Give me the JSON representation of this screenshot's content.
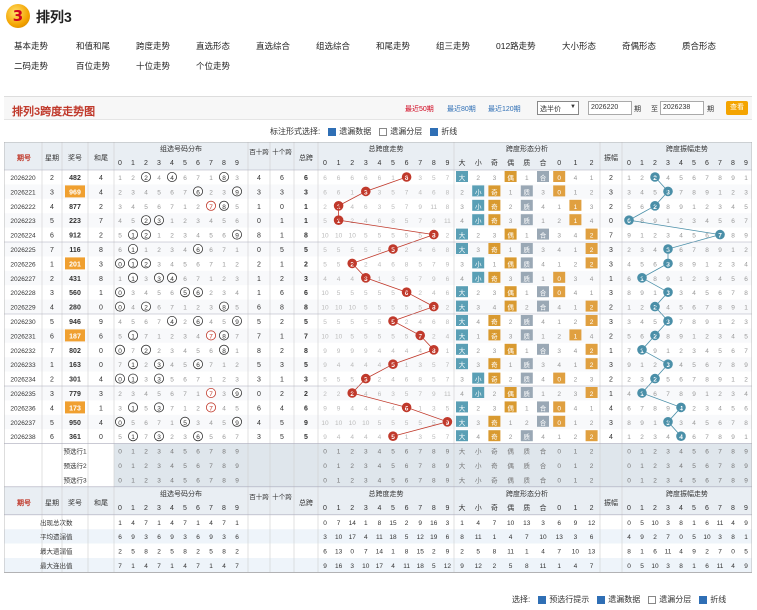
{
  "logo": {
    "badge": "3",
    "title": "排列3"
  },
  "nav": {
    "row1": [
      "基本走势",
      "和值和尾",
      "跨度走势",
      "直选形态",
      "直选综合",
      "组选综合",
      "和尾走势",
      "组三走势",
      "012路走势",
      "大小形态",
      "奇偶形态",
      "质合形态"
    ],
    "row2": [
      "二码走势",
      "百位走势",
      "十位走势",
      "个位走势"
    ]
  },
  "panel": {
    "title": "排列3跨度走势图",
    "recent50": "最近50期",
    "recent80": "最近80期",
    "recent120": "最近120期",
    "select_value": "选半价",
    "from_value": "2026220",
    "from_suffix": "期",
    "to_label": "至",
    "to_value": "2026238",
    "to_suffix": "期",
    "query": "查看"
  },
  "options": {
    "label": "标注形式选择:",
    "items": [
      {
        "label": "遗漏数据",
        "checked": true
      },
      {
        "label": "遗漏分层",
        "checked": false
      },
      {
        "label": "折线",
        "checked": true
      }
    ]
  },
  "table": {
    "h_period": "期号",
    "h_week": "星期",
    "h_prize": "奖号",
    "h_sumtail": "和尾",
    "h_combo": "组选号码分布",
    "h_bs": "百十跨",
    "h_tg": "十个跨",
    "h_total": "总跨",
    "h_totaltrend": "总跨度走势",
    "h_shape": "跨度形态分析",
    "h_swing": "振幅",
    "h_swingtrend": "跨度振幅走势",
    "shape_cols": [
      "大",
      "小",
      "奇",
      "偶",
      "质",
      "合",
      "0",
      "1",
      "2"
    ],
    "digits": [
      "0",
      "1",
      "2",
      "3",
      "4",
      "5",
      "6",
      "7",
      "8",
      "9"
    ],
    "rows": [
      {
        "p": "2026220",
        "w": "2",
        "n": "482",
        "t": "4",
        "bs": "4",
        "tg": "6",
        "sp": 6,
        "sw": "2"
      },
      {
        "p": "2026221",
        "w": "3",
        "n": "969",
        "t": "4",
        "bs": "3",
        "tg": "3",
        "sp": 3,
        "sw": "3"
      },
      {
        "p": "2026222",
        "w": "4",
        "n": "877",
        "t": "2",
        "bs": "1",
        "tg": "0",
        "sp": 1,
        "sw": "2"
      },
      {
        "p": "2026223",
        "w": "5",
        "n": "223",
        "t": "7",
        "bs": "0",
        "tg": "1",
        "sp": 1,
        "sw": "0"
      },
      {
        "p": "2026224",
        "w": "6",
        "n": "912",
        "t": "2",
        "bs": "8",
        "tg": "1",
        "sp": 8,
        "sw": "7"
      },
      {
        "p": "2026225",
        "w": "7",
        "n": "116",
        "t": "8",
        "bs": "0",
        "tg": "5",
        "sp": 5,
        "sw": "3"
      },
      {
        "p": "2026226",
        "w": "1",
        "n": "201",
        "t": "3",
        "bs": "2",
        "tg": "1",
        "sp": 2,
        "sw": "3"
      },
      {
        "p": "2026227",
        "w": "2",
        "n": "431",
        "t": "8",
        "bs": "1",
        "tg": "2",
        "sp": 3,
        "sw": "1"
      },
      {
        "p": "2026228",
        "w": "3",
        "n": "560",
        "t": "1",
        "bs": "1",
        "tg": "6",
        "sp": 6,
        "sw": "3"
      },
      {
        "p": "2026229",
        "w": "4",
        "n": "280",
        "t": "0",
        "bs": "6",
        "tg": "8",
        "sp": 8,
        "sw": "2"
      },
      {
        "p": "2026230",
        "w": "5",
        "n": "946",
        "t": "9",
        "bs": "5",
        "tg": "2",
        "sp": 5,
        "sw": "3"
      },
      {
        "p": "2026231",
        "w": "6",
        "n": "187",
        "t": "6",
        "bs": "7",
        "tg": "1",
        "sp": 7,
        "sw": "2"
      },
      {
        "p": "2026232",
        "w": "7",
        "n": "802",
        "t": "0",
        "bs": "8",
        "tg": "2",
        "sp": 8,
        "sw": "1"
      },
      {
        "p": "2026233",
        "w": "1",
        "n": "163",
        "t": "0",
        "bs": "5",
        "tg": "3",
        "sp": 5,
        "sw": "3"
      },
      {
        "p": "2026234",
        "w": "2",
        "n": "301",
        "t": "4",
        "bs": "3",
        "tg": "1",
        "sp": 3,
        "sw": "2"
      },
      {
        "p": "2026235",
        "w": "3",
        "n": "779",
        "t": "3",
        "bs": "0",
        "tg": "2",
        "sp": 2,
        "sw": "1"
      },
      {
        "p": "2026236",
        "w": "4",
        "n": "173",
        "t": "1",
        "bs": "6",
        "tg": "4",
        "sp": 6,
        "sw": "4"
      },
      {
        "p": "2026237",
        "w": "5",
        "n": "950",
        "t": "4",
        "bs": "4",
        "tg": "5",
        "sp": 9,
        "sw": "3"
      },
      {
        "p": "2026238",
        "w": "6",
        "n": "361",
        "t": "0",
        "bs": "3",
        "tg": "5",
        "sp": 5,
        "sw": "4"
      }
    ],
    "preview": [
      "预选行1",
      "预选行2",
      "预选行3"
    ],
    "stats_labels": [
      "出现总次数",
      "平均遗漏值",
      "最大遗漏值",
      "最大连出值"
    ]
  },
  "footer": {
    "label": "选择:",
    "items": [
      {
        "label": "预选行提示",
        "checked": true
      },
      {
        "label": "遗漏数据",
        "checked": true
      },
      {
        "label": "遗漏分层",
        "checked": false
      },
      {
        "label": "折线",
        "checked": true
      }
    ]
  },
  "colors": {
    "accent": "#c0392b",
    "ball": "#c0392b",
    "swing_ball": "#4a8fa8",
    "grid": "#cfcfcf",
    "header_bg": "#e9eef3"
  }
}
